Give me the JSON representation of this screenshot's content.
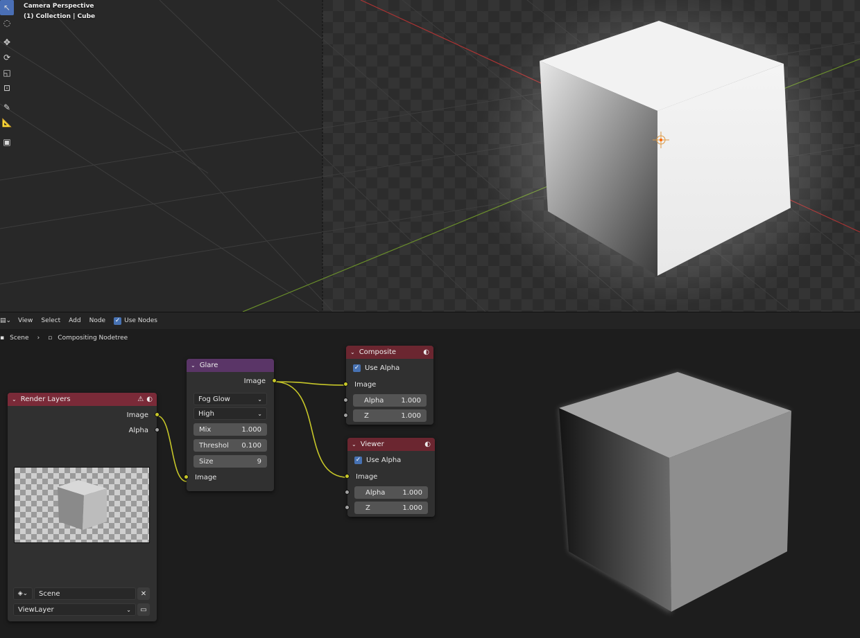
{
  "viewport": {
    "overlay_title": "Camera Perspective",
    "overlay_subtitle": "(1) Collection | Cube",
    "tools": [
      "select-box-icon",
      "cursor-icon",
      "move-icon",
      "rotate-icon",
      "scale-icon",
      "transform-icon",
      "annotate-icon",
      "measure-icon",
      "add-cube-icon"
    ]
  },
  "node_editor": {
    "menus": [
      "View",
      "Select",
      "Add",
      "Node"
    ],
    "use_nodes_label": "Use Nodes",
    "breadcrumb": {
      "scene": "Scene",
      "tree": "Compositing Nodetree"
    },
    "render_layers": {
      "title": "Render Layers",
      "outputs": [
        "Image",
        "Alpha"
      ],
      "scene_value": "Scene",
      "layer_value": "ViewLayer"
    },
    "glare": {
      "title": "Glare",
      "output": "Image",
      "glare_type": "Fog Glow",
      "quality": "High",
      "mix_label": "Mix",
      "mix_value": "1.000",
      "threshold_label": "Threshol",
      "threshold_value": "0.100",
      "size_label": "Size",
      "size_value": "9",
      "input": "Image"
    },
    "composite": {
      "title": "Composite",
      "use_alpha": "Use Alpha",
      "input_image": "Image",
      "alpha_label": "Alpha",
      "alpha_value": "1.000",
      "z_label": "Z",
      "z_value": "1.000"
    },
    "viewer": {
      "title": "Viewer",
      "use_alpha": "Use Alpha",
      "input_image": "Image",
      "alpha_label": "Alpha",
      "alpha_value": "1.000",
      "z_label": "Z",
      "z_value": "1.000"
    }
  },
  "colors": {
    "socket_image": "#c7c729",
    "socket_value": "#a1a1a1",
    "render_layers_header": "#7a2a38",
    "glare_header": "#5a3567",
    "output_header": "#6b2630",
    "accent": "#4772b3"
  }
}
